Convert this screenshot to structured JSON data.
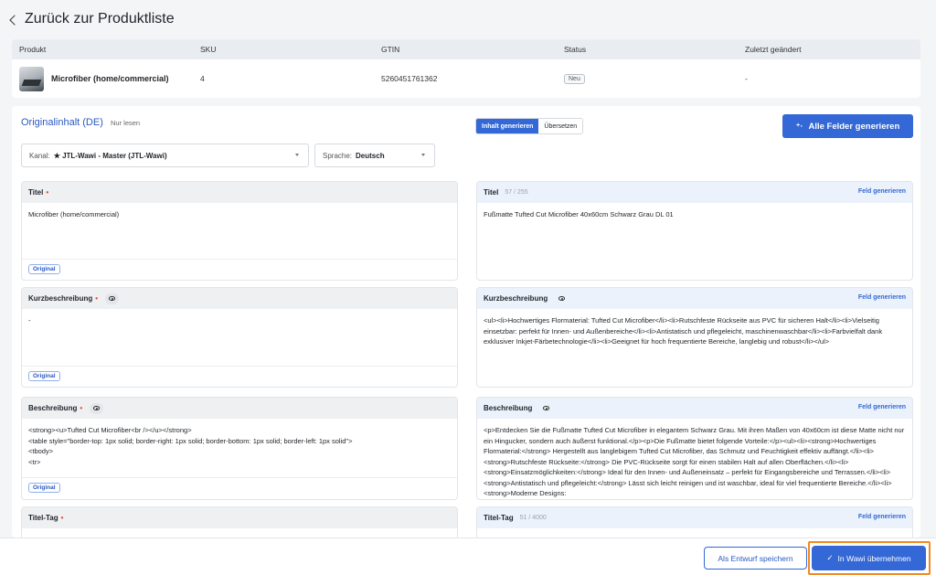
{
  "header": {
    "back_label": "Zurück zur Produktliste"
  },
  "product_table": {
    "columns": [
      "Produkt",
      "SKU",
      "GTIN",
      "Status",
      "Zuletzt geändert"
    ],
    "row": {
      "name": "Microfiber (home/commercial)",
      "sku": "4",
      "gtin": "5260451761362",
      "status": "Neu",
      "changed": "-"
    }
  },
  "main": {
    "original_title": "Originalinhalt (DE)",
    "readonly": "Nur lesen",
    "tabs": [
      {
        "label": "Inhalt generieren",
        "active": true
      },
      {
        "label": "Übersetzen",
        "active": false
      }
    ],
    "generate_all": "Alle Felder generieren",
    "channel": {
      "label": "Kanal:",
      "value": "★ JTL-Wawi - Master (JTL-Wawi)"
    },
    "language": {
      "label": "Sprache:",
      "value": "Deutsch"
    }
  },
  "left_fields": [
    {
      "title": "Titel",
      "value": "Microfiber (home/commercial)",
      "badge": "Original"
    },
    {
      "title": "Kurzbeschreibung",
      "value": "-",
      "badge": "Original"
    },
    {
      "title": "Beschreibung",
      "value": "<strong><u>Tufted Cut Microfiber<br /></u></strong>\n<table style=\"border-top: 1px solid; border-right: 1px solid; border-bottom: 1px solid; border-left: 1px solid\">\n<tbody>\n<tr>",
      "badge": "Original"
    },
    {
      "title": "Titel-Tag",
      "value": "",
      "badge": ""
    }
  ],
  "right_fields": [
    {
      "title": "Titel",
      "count": "57 / 255",
      "action": "Feld generieren",
      "value": "Fußmatte Tufted Cut Microfiber 40x60cm Schwarz Grau DL 01"
    },
    {
      "title": "Kurzbeschreibung",
      "count": "",
      "action": "Feld generieren",
      "value": "<ul><li>Hochwertiges Flormaterial: Tufted Cut Microfiber</li><li>Rutschfeste Rückseite aus PVC für sicheren Halt</li><li>Vielseitig einsetzbar: perfekt für Innen- und Außenbereiche</li><li>Antistatisch und pflegeleicht, maschinenwaschbar</li><li>Farbvielfalt dank exklusiver Inkjet-Färbetechnologie</li><li>Geeignet für hoch frequentierte Bereiche, langlebig und robust</li></ul>"
    },
    {
      "title": "Beschreibung",
      "count": "",
      "action": "Feld generieren",
      "value": "<p>Entdecken Sie die Fußmatte Tufted Cut Microfiber in elegantem Schwarz Grau. Mit ihren Maßen von 40x60cm ist diese Matte nicht nur ein Hingucker, sondern auch äußerst funktional.</p><p>Die Fußmatte bietet folgende Vorteile:</p><ul><li><strong>Hochwertiges Flormaterial:</strong> Hergestellt aus langlebigem Tufted Cut Microfiber, das Schmutz und Feuchtigkeit effektiv auffängt.</li><li><strong>Rutschfeste Rückseite:</strong> Die PVC-Rückseite sorgt für einen stabilen Halt auf allen Oberflächen.</li><li><strong>Einsatzmöglichkeiten:</strong> Ideal für den Innen- und Außeneinsatz – perfekt für Eingangsbereiche und Terrassen.</li><li><strong>Antistatisch und pflegeleicht:</strong> Lässt sich leicht reinigen und ist waschbar, ideal für viel frequentierte Bereiche.</li><li><strong>Moderne Designs:"
    },
    {
      "title": "Titel-Tag",
      "count": "51 / 4000",
      "action": "Feld generieren",
      "value": ""
    }
  ],
  "footer": {
    "draft_label": "Als Entwurf speichern",
    "apply_label": "In Wawi übernehmen"
  },
  "colors": {
    "accent": "#3368d6",
    "highlight": "#f08a24",
    "required": "#e24a2b"
  }
}
